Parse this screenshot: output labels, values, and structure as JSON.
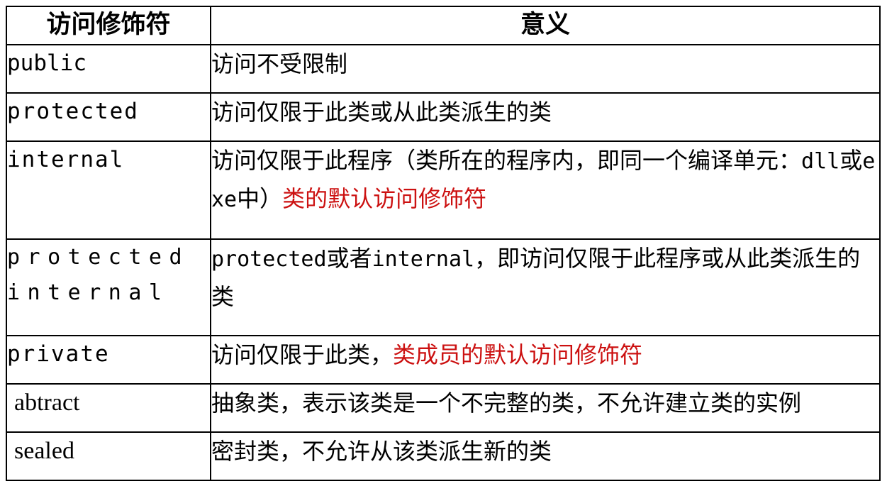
{
  "table": {
    "headers": {
      "modifier": "访问修饰符",
      "meaning": "意义"
    },
    "accent_colors": {
      "highlight_red": "#cc1111",
      "text_black": "#000000",
      "border_black": "#000000",
      "background_white": "#ffffff"
    },
    "rows": [
      {
        "modifier": "public",
        "meaning_black_1": "访问不受限制",
        "meaning_red_1": "",
        "meaning_black_2": ""
      },
      {
        "modifier": "protected",
        "meaning_black_1": "访问仅限于此类或从此类派生的类",
        "meaning_red_1": "",
        "meaning_black_2": ""
      },
      {
        "modifier": "internal",
        "meaning_black_1": "访问仅限于此程序（类所在的程序内，即同一个编译单元：",
        "meaning_mono_1": "dll",
        "meaning_black_mid": "或",
        "meaning_mono_2": "exe",
        "meaning_black_2": "中）",
        "meaning_red_1": "类的默认访问修饰符"
      },
      {
        "modifier": "protected internal",
        "meaning_mono_1": "protected",
        "meaning_black_mid": "或者",
        "meaning_mono_2": "internal",
        "meaning_black_1": "，即访问仅限于此程序或从此类派生的类",
        "meaning_red_1": ""
      },
      {
        "modifier": "private",
        "meaning_black_1": "访问仅限于此类，",
        "meaning_red_1": "类成员的默认访问修饰符",
        "meaning_black_2": ""
      },
      {
        "modifier": "abtract",
        "meaning_black_1": "抽象类，表示该类是一个不完整的类，不允许建立类的实例",
        "meaning_red_1": "",
        "meaning_black_2": ""
      },
      {
        "modifier": "sealed",
        "meaning_black_1": "密封类，不允许从该类派生新的类",
        "meaning_red_1": "",
        "meaning_black_2": ""
      }
    ]
  }
}
